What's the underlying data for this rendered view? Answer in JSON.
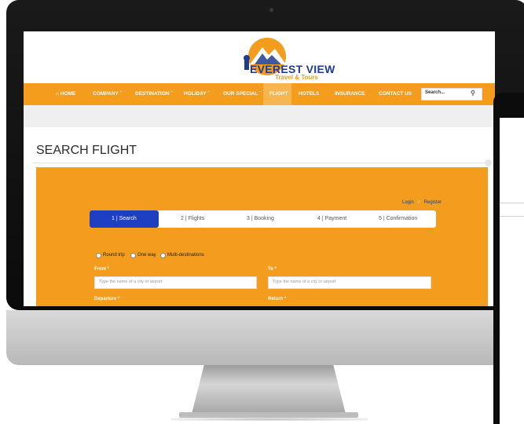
{
  "logo": {
    "name": "EVEREST VIEW",
    "tagline": "Travel & Tours"
  },
  "nav": {
    "home": "HOME",
    "company": "COMPANY",
    "destination": "DESTINATION",
    "holiday": "HOLIDAY",
    "special": "OUR SPECIAL",
    "flight": "FLIGHT",
    "hotels": "HOTELS",
    "insurance": "INSURANCE",
    "contact": "CONTACT US"
  },
  "search": {
    "value": "Search..."
  },
  "page": {
    "title": "SEARCH FLIGHT"
  },
  "auth": {
    "login": "Login",
    "sep": "/",
    "register": "Register"
  },
  "steps": [
    "1 | Search",
    "2 | Flights",
    "3 | Booking",
    "4 | Payment",
    "5 | Confirmation"
  ],
  "trip_types": [
    "Round trip",
    "One way",
    "Multi-destinations"
  ],
  "form": {
    "from_label": "From *",
    "from_placeholder": "Type the name of a city or airport",
    "to_label": "To *",
    "to_placeholder": "Type the name of a city or airport",
    "departure_label": "Departure *",
    "return_label": "Return *"
  },
  "colors": {
    "brand_orange": "#f39c1d",
    "active_step": "#1e3fc1",
    "brand_blue": "#1f3b8e"
  }
}
